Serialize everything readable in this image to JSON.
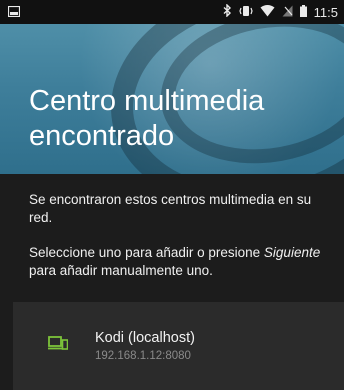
{
  "status_bar": {
    "time": "11:5",
    "icons": [
      "notification-icon",
      "bluetooth-icon",
      "vibrate-icon",
      "wifi-icon",
      "no-sim-icon",
      "battery-icon"
    ]
  },
  "header": {
    "title": "Centro multimedia encontrado"
  },
  "body": {
    "message_1": "Se encontraron estos centros multimedia en su red.",
    "message_2_prefix": "Seleccione uno para añadir o presione ",
    "message_2_emphasis": "Siguiente",
    "message_2_suffix": " para añadir manualmente uno."
  },
  "hosts": [
    {
      "name": "Kodi (localhost)",
      "address": "192.168.1.12:8080",
      "icon": "media-center-icon",
      "icon_color": "#7cc33a"
    }
  ],
  "colors": {
    "background": "#1c1c1c",
    "card": "#2b2b2b",
    "accent_green": "#7cc33a"
  }
}
